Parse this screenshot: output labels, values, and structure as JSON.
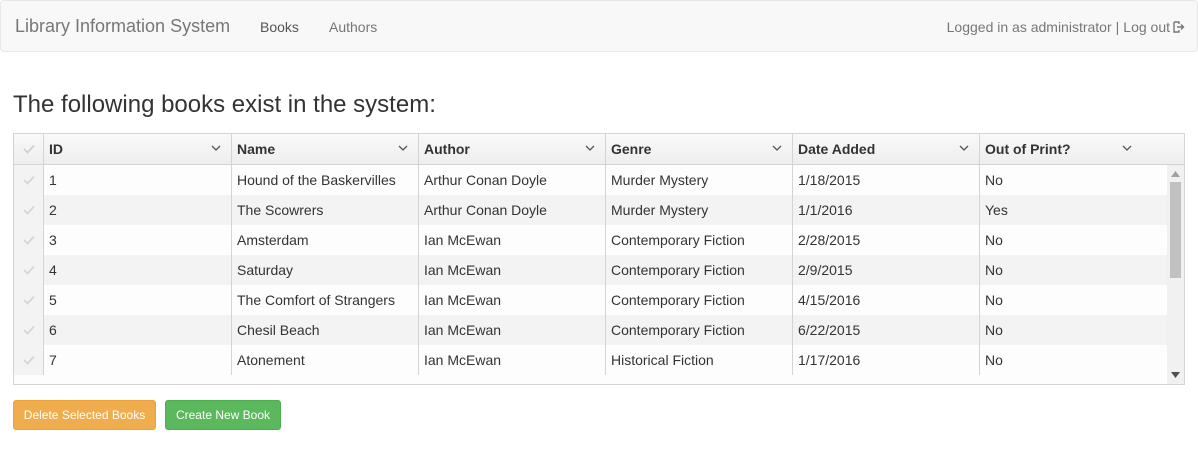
{
  "navbar": {
    "brand": "Library Information System",
    "links": {
      "books": "Books",
      "authors": "Authors"
    },
    "user_text": "Logged in as administrator",
    "separator": "|",
    "logout": "Log out"
  },
  "heading": "The following books exist in the system:",
  "grid": {
    "columns": [
      "ID",
      "Name",
      "Author",
      "Genre",
      "Date Added",
      "Out of Print?"
    ],
    "rows": [
      [
        "1",
        "Hound of the Baskervilles",
        "Arthur Conan Doyle",
        "Murder Mystery",
        "1/18/2015",
        "No"
      ],
      [
        "2",
        "The Scowrers",
        "Arthur Conan Doyle",
        "Murder Mystery",
        "1/1/2016",
        "Yes"
      ],
      [
        "3",
        "Amsterdam",
        "Ian McEwan",
        "Contemporary Fiction",
        "2/28/2015",
        "No"
      ],
      [
        "4",
        "Saturday",
        "Ian McEwan",
        "Contemporary Fiction",
        "2/9/2015",
        "No"
      ],
      [
        "5",
        "The Comfort of Strangers",
        "Ian McEwan",
        "Contemporary Fiction",
        "4/15/2016",
        "No"
      ],
      [
        "6",
        "Chesil Beach",
        "Ian McEwan",
        "Contemporary Fiction",
        "6/22/2015",
        "No"
      ],
      [
        "7",
        "Atonement",
        "Ian McEwan",
        "Historical Fiction",
        "1/17/2016",
        "No"
      ]
    ]
  },
  "buttons": {
    "delete": "Delete Selected Books",
    "create": "Create New Book"
  },
  "colors": {
    "warning": "#f0ad4e",
    "success": "#5cb85c",
    "navbar_bg": "#f8f8f8"
  },
  "icons": {
    "logout": "logout-icon",
    "select": "check-icon",
    "sort": "chevron-down-icon"
  }
}
